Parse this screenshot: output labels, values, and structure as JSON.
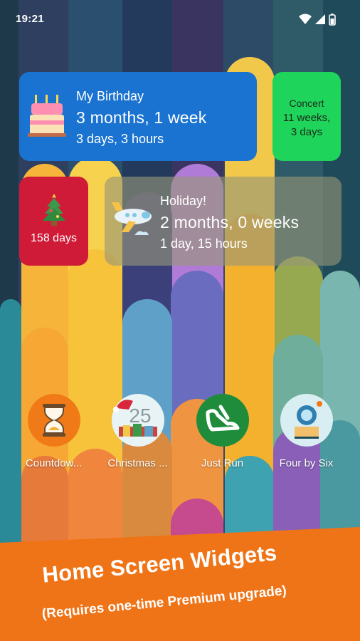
{
  "status_bar": {
    "time": "19:21"
  },
  "widgets": {
    "birthday": {
      "title": "My Birthday",
      "main": "3 months, 1 week",
      "sub": "3 days, 3 hours",
      "icon": "birthday-cake-icon",
      "color": "#1a73d0"
    },
    "concert": {
      "title": "Concert",
      "line1": "11 weeks,",
      "line2": "3 days",
      "color": "#1fd45a"
    },
    "christmas": {
      "days": "158 days",
      "icon": "christmas-tree-icon",
      "color": "#cf1b38"
    },
    "holiday": {
      "title": "Holiday!",
      "main": "2 months, 0 weeks",
      "sub": "1 day, 15 hours",
      "icon": "airplane-icon"
    }
  },
  "apps": [
    {
      "label": "Countdow...",
      "icon": "hourglass-icon",
      "color": "#f07a17"
    },
    {
      "label": "Christmas ...",
      "icon": "christmas-countdown-icon",
      "badge": "25"
    },
    {
      "label": "Just Run",
      "icon": "running-shoe-icon",
      "color": "#1e8c3a"
    },
    {
      "label": "Four by Six",
      "icon": "camera-icon",
      "color": "#d8eef3"
    }
  ],
  "banner": {
    "title": "Home Screen Widgets",
    "subtitle": "(Requires one-time Premium upgrade)",
    "color": "#ef7417"
  }
}
